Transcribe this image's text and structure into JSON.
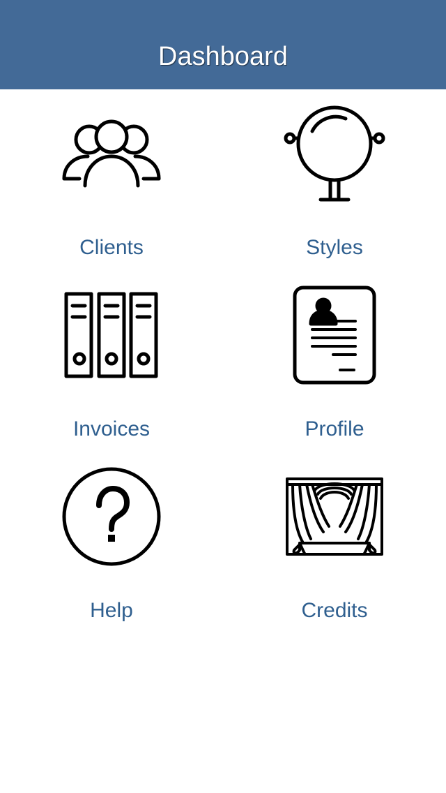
{
  "navbar": {
    "title": "Dashboard",
    "background_color": "#436a97"
  },
  "menu": {
    "label_color": "#2f5f8f",
    "items": [
      {
        "label": "Clients",
        "icon": "users-icon"
      },
      {
        "label": "Styles",
        "icon": "mirror-icon"
      },
      {
        "label": "Invoices",
        "icon": "binders-icon"
      },
      {
        "label": "Profile",
        "icon": "resume-icon"
      },
      {
        "label": "Help",
        "icon": "question-icon"
      },
      {
        "label": "Credits",
        "icon": "curtains-icon"
      }
    ]
  }
}
